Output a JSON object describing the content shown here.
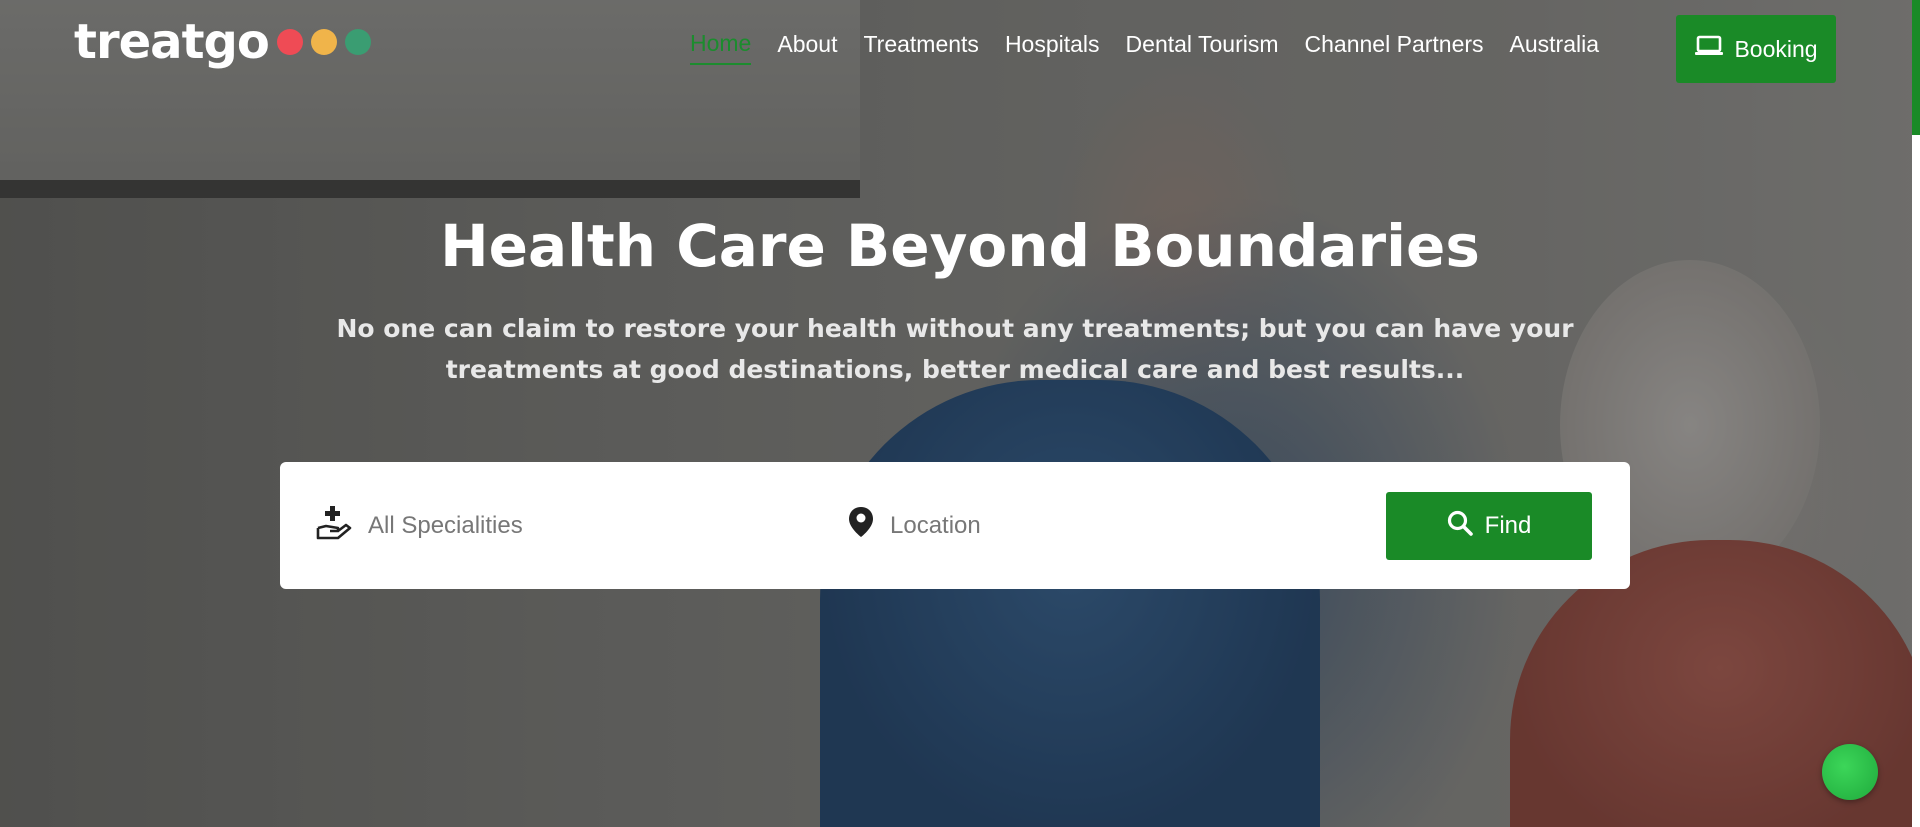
{
  "brand": {
    "name": "treatgo",
    "dot_colors": [
      "#ef4b55",
      "#f0b44a",
      "#3a9d72"
    ]
  },
  "nav": {
    "items": [
      {
        "label": "Home",
        "active": true
      },
      {
        "label": "About"
      },
      {
        "label": "Treatments"
      },
      {
        "label": "Hospitals"
      },
      {
        "label": "Dental Tourism"
      },
      {
        "label": "Channel Partners"
      },
      {
        "label": "Australia"
      }
    ],
    "booking_label": "Booking",
    "booking_icon": "laptop-icon"
  },
  "hero": {
    "title": "Health Care Beyond Boundaries",
    "subtitle": "No one can claim to restore your health without any treatments; but you can have your treatments at good destinations, better medical care and best results..."
  },
  "search": {
    "speciality_placeholder": "All Specialities",
    "speciality_icon": "hand-plus-icon",
    "location_placeholder": "Location",
    "location_icon": "map-pin-icon",
    "find_label": "Find",
    "find_icon": "search-icon"
  },
  "colors": {
    "accent": "#1a8a27",
    "active_nav": "#1c8c2e"
  }
}
